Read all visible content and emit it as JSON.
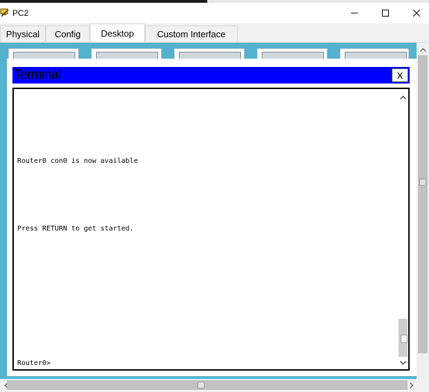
{
  "window": {
    "title": "PC2",
    "icon": "packet-tracer-pc-icon",
    "controls": [
      "minimize-icon",
      "maximize-icon",
      "close-icon"
    ]
  },
  "tabs": [
    {
      "label": "Physical",
      "active": false
    },
    {
      "label": "Config",
      "active": false
    },
    {
      "label": "Desktop",
      "active": true
    },
    {
      "label": "Custom Interface",
      "active": false
    }
  ],
  "terminal": {
    "title": "Terminal",
    "close_label": "X",
    "lines": [
      "Router0 con0 is now available",
      "Press RETURN to get started.",
      "Router0>"
    ]
  },
  "colors": {
    "terminal_header": "#0000ff",
    "desktop_background": "#55b2cf"
  }
}
